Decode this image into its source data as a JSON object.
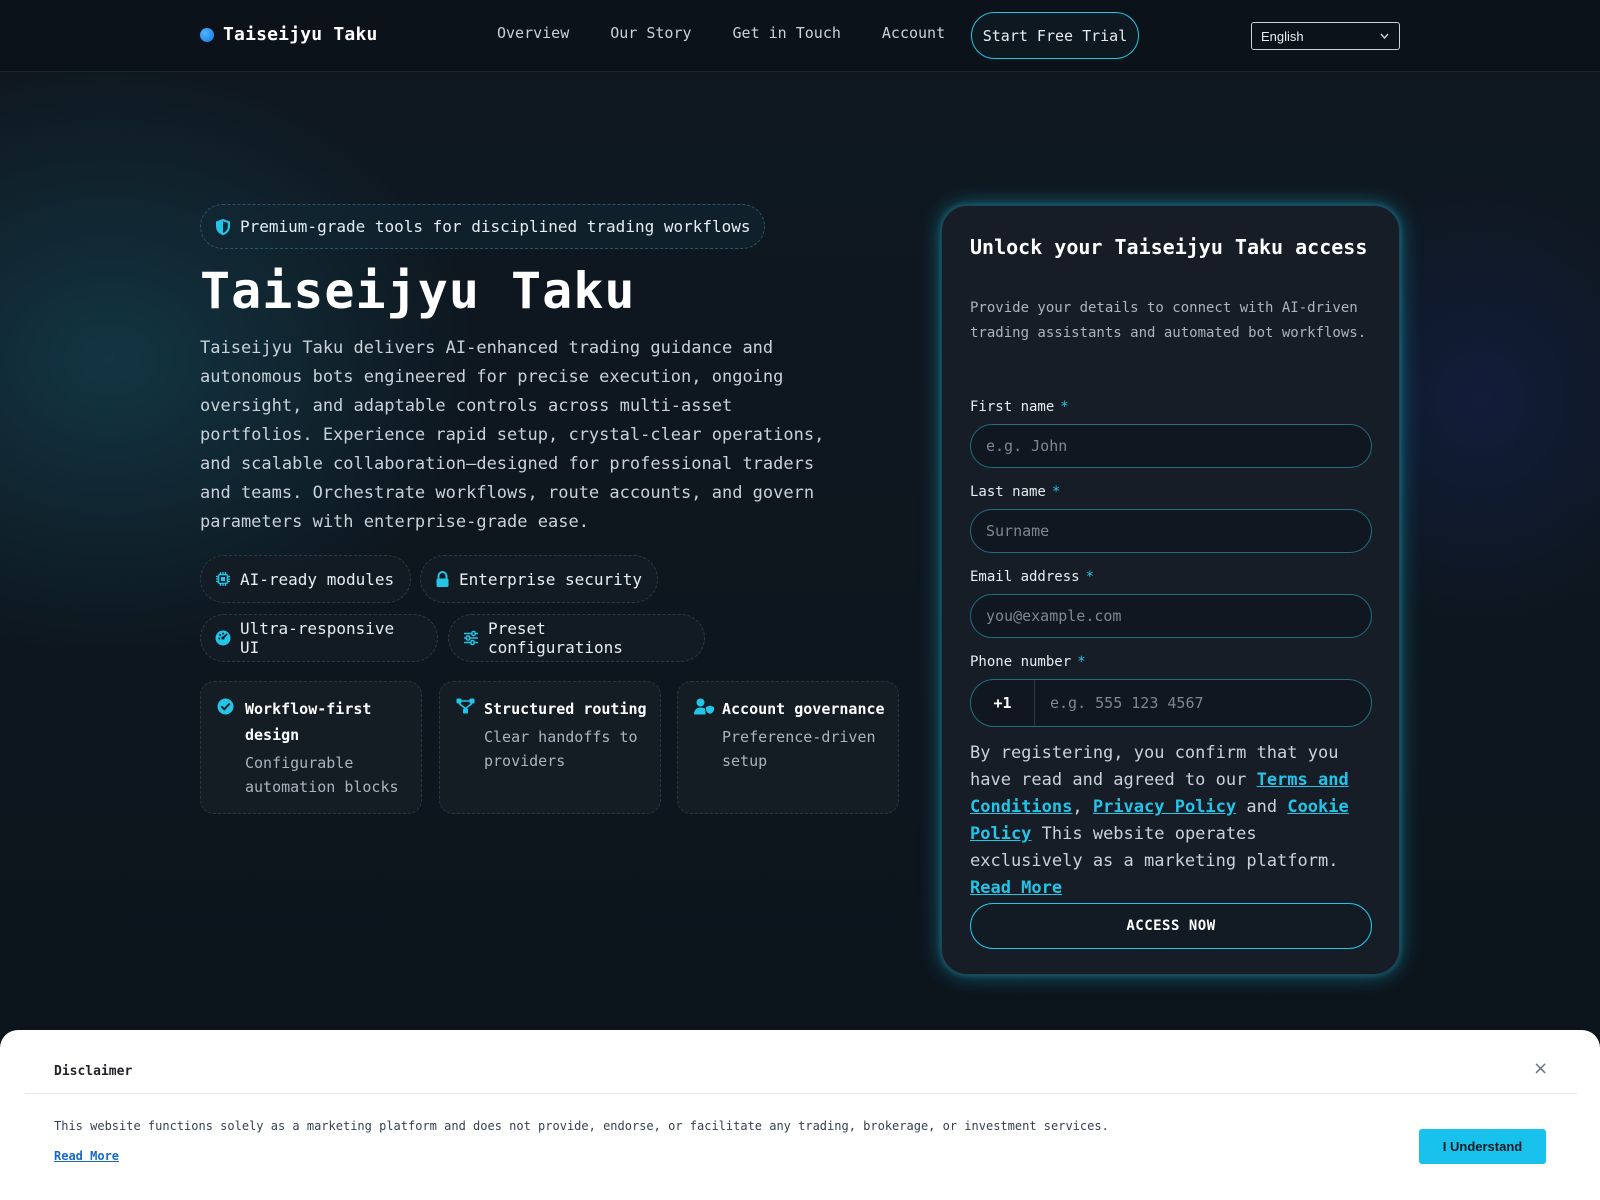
{
  "header": {
    "brand": "Taiseijyu Taku",
    "nav": [
      "Overview",
      "Our Story",
      "Get in Touch",
      "Account"
    ],
    "cta": "Start Free Trial",
    "language": "English"
  },
  "hero": {
    "badge": "Premium-grade tools for disciplined trading workflows",
    "title": "Taiseijyu Taku",
    "description": "Taiseijyu Taku delivers AI-enhanced trading guidance and autonomous bots engineered for precise execution, ongoing oversight, and adaptable controls across multi-asset portfolios. Experience rapid setup, crystal-clear operations, and scalable collaboration—designed for professional traders and teams. Orchestrate workflows, route accounts, and govern parameters with enterprise-grade ease.",
    "chips": [
      {
        "label": "AI-ready modules",
        "icon": "chip-icon"
      },
      {
        "label": "Enterprise security",
        "icon": "lock-icon"
      },
      {
        "label": "Ultra-responsive UI",
        "icon": "gauge-icon"
      },
      {
        "label": "Preset configurations",
        "icon": "sliders-icon"
      }
    ],
    "cards": [
      {
        "title": "Workflow-first design",
        "subtitle": "Configurable automation blocks",
        "icon": "check-circle-icon"
      },
      {
        "title": "Structured routing",
        "subtitle": "Clear handoffs to providers",
        "icon": "route-icon"
      },
      {
        "title": "Account governance",
        "subtitle": "Preference-driven setup",
        "icon": "user-shield-icon"
      }
    ]
  },
  "form": {
    "title": "Unlock your Taiseijyu Taku access",
    "subtitle": "Provide your details to connect with AI-driven trading assistants and automated bot workflows.",
    "required_mark": "*",
    "first_name": {
      "label": "First name",
      "placeholder": "e.g. John"
    },
    "last_name": {
      "label": "Last name",
      "placeholder": "Surname"
    },
    "email": {
      "label": "Email address",
      "placeholder": "you@example.com"
    },
    "phone": {
      "label": "Phone number",
      "code": "+1",
      "placeholder": "e.g. 555 123 4567"
    },
    "consent": {
      "intro": "By registering, you confirm that you have read and agreed to our ",
      "terms": "Terms and Conditions",
      "comma": ", ",
      "privacy": "Privacy Policy",
      "and": " and ",
      "cookie": "Cookie Policy",
      "outro": " This website operates exclusively as a marketing platform. ",
      "read_more": "Read More"
    },
    "submit": "ACCESS NOW"
  },
  "disclaimer": {
    "title": "Disclaimer",
    "close": "×",
    "text": "This website functions solely as a marketing platform and does not provide, endorse, or facilitate any trading, brokerage, or investment services.",
    "read_more": "Read More",
    "button": "I Understand"
  },
  "colors": {
    "accent": "#1ec6e8",
    "background": "#0d141c",
    "panel": "#161d27",
    "disclaimer_button": "#19c2ec"
  }
}
